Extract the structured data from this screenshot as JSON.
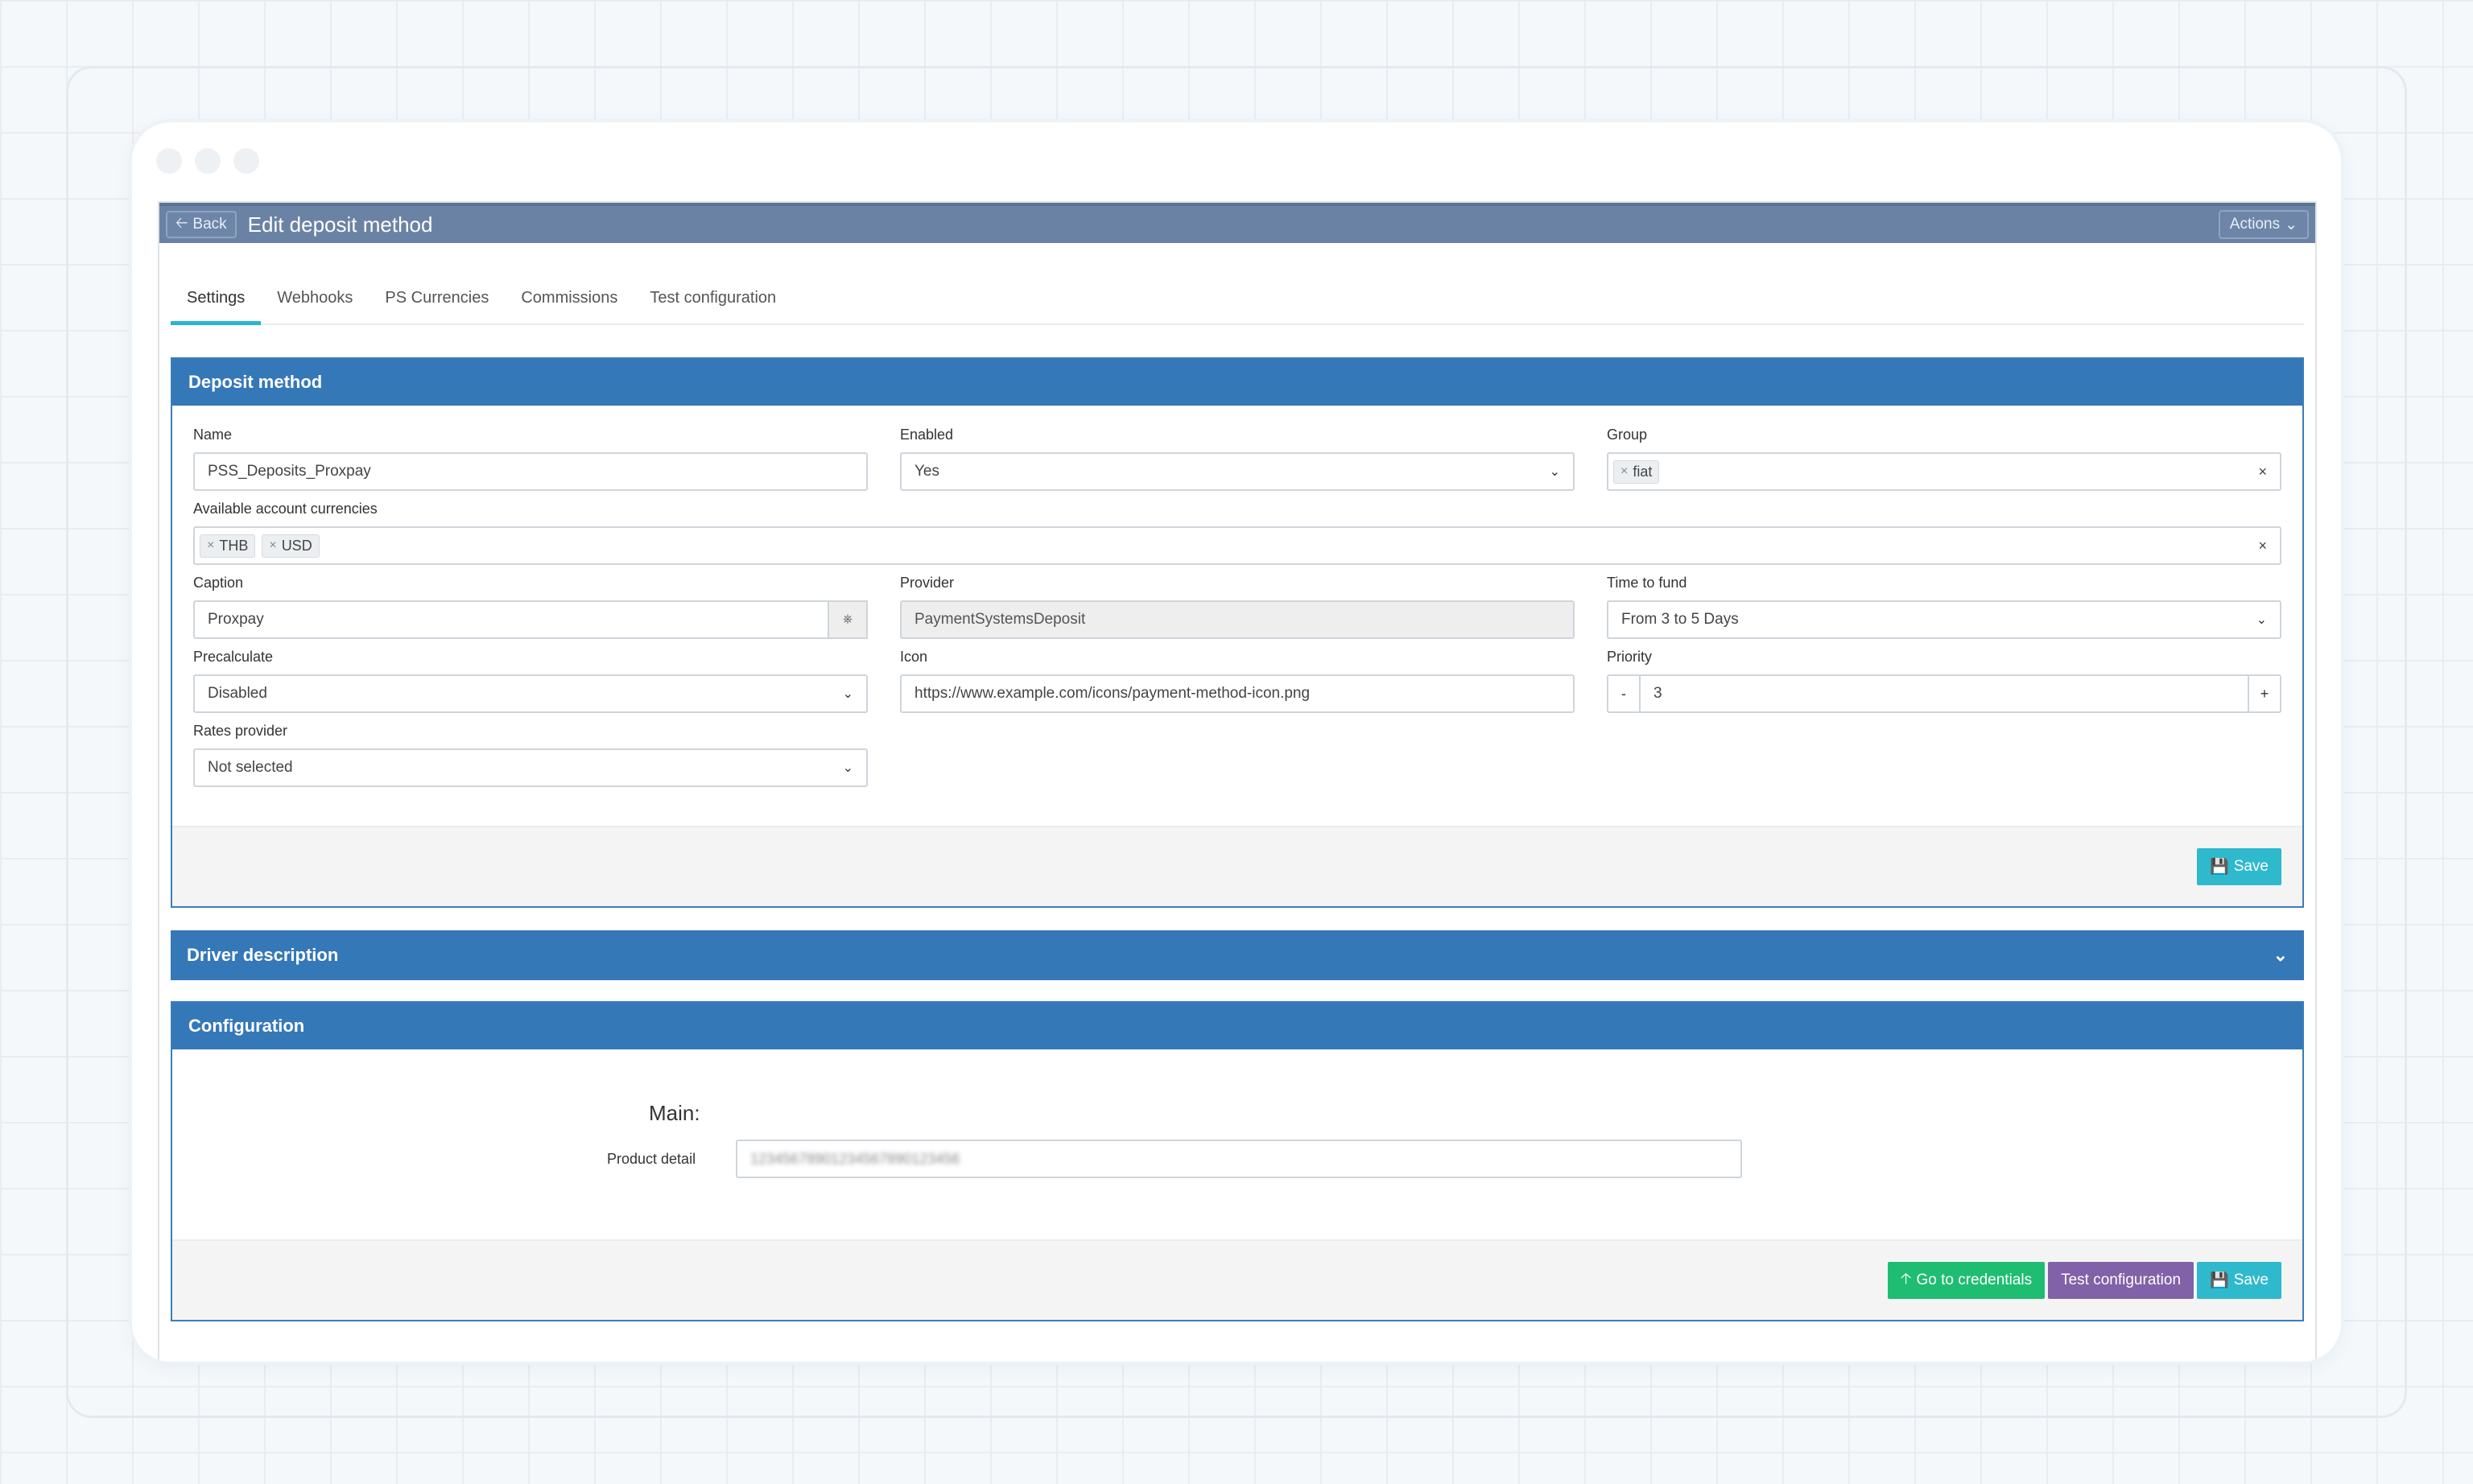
{
  "header": {
    "back_label": "Back",
    "title": "Edit deposit method",
    "actions_label": "Actions"
  },
  "tabs": [
    {
      "label": "Settings",
      "active": true
    },
    {
      "label": "Webhooks"
    },
    {
      "label": "PS Currencies"
    },
    {
      "label": "Commissions"
    },
    {
      "label": "Test configuration"
    }
  ],
  "deposit_method": {
    "title": "Deposit method",
    "name": {
      "label": "Name",
      "value": "PSS_Deposits_Proxpay"
    },
    "enabled": {
      "label": "Enabled",
      "value": "Yes"
    },
    "group": {
      "label": "Group",
      "tags": [
        "fiat"
      ]
    },
    "currencies": {
      "label": "Available account currencies",
      "tags": [
        "THB",
        "USD"
      ]
    },
    "caption": {
      "label": "Caption",
      "value": "Proxpay"
    },
    "provider": {
      "label": "Provider",
      "value": "PaymentSystemsDeposit"
    },
    "time_to_fund": {
      "label": "Time to fund",
      "value": "From 3 to 5 Days"
    },
    "precalculate": {
      "label": "Precalculate",
      "value": "Disabled"
    },
    "icon": {
      "label": "Icon",
      "value": "https://www.example.com/icons/payment-method-icon.png"
    },
    "priority": {
      "label": "Priority",
      "value": "3",
      "minus": "-",
      "plus": "+"
    },
    "rates_provider": {
      "label": "Rates provider",
      "value": "Not selected"
    },
    "save_label": "Save"
  },
  "driver_description": {
    "title": "Driver description"
  },
  "configuration": {
    "title": "Configuration",
    "section_label": "Main:",
    "product_detail": {
      "label": "Product detail",
      "value": "12345678901234567890123456"
    },
    "go_to_credentials_label": "Go to credentials",
    "test_configuration_label": "Test configuration",
    "save_label": "Save"
  },
  "colors": {
    "header_bar": "#6a82a4",
    "panel_blue": "#3578b8",
    "save_cyan": "#2fb9cd",
    "credentials_green": "#1fbd72",
    "test_purple": "#8161a8",
    "tab_active_underline": "#2db4cf"
  }
}
